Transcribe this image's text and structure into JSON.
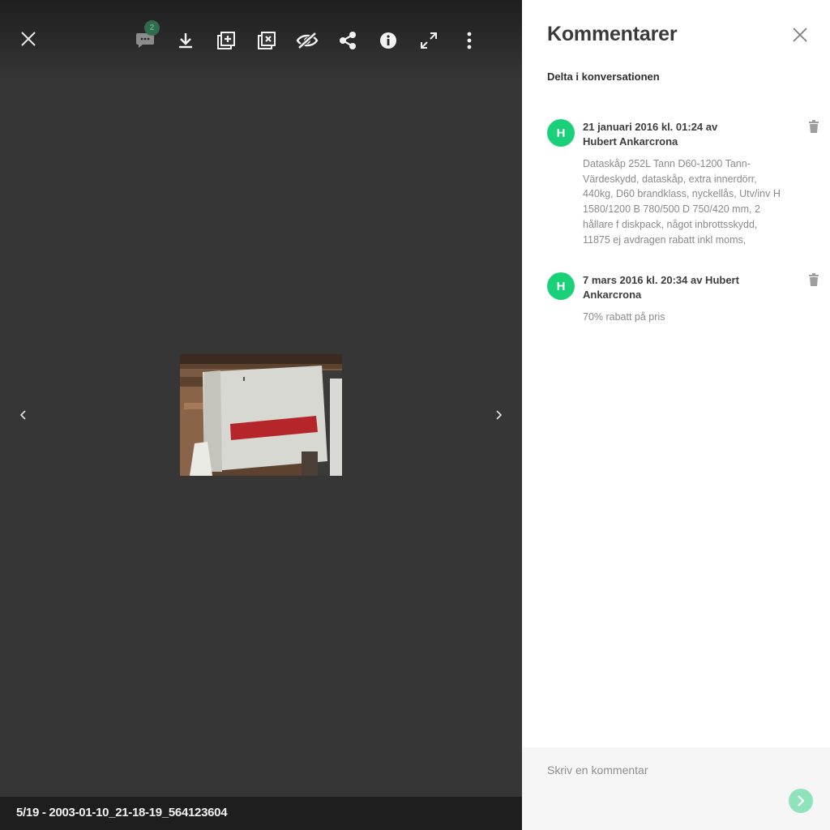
{
  "toolbar": {
    "comment_count": "2",
    "icons": [
      "close-icon",
      "comments-icon",
      "download-icon",
      "add-to-album-icon",
      "remove-from-album-icon",
      "hide-icon",
      "share-icon",
      "info-icon",
      "fullscreen-icon",
      "more-icon"
    ]
  },
  "viewer": {
    "caption": "5/19 - 2003-01-10_21-18-19_564123604",
    "background": "#363636"
  },
  "panel": {
    "title": "Kommentarer",
    "join_label": "Delta i konversationen",
    "comments": [
      {
        "avatar_initial": "H",
        "header": "21 januari 2016 kl. 01:24 av Hubert Ankarcrona",
        "body": "Dataskåp 252L Tann D60-1200 Tann-Värdeskydd, dataskåp, extra innerdörr, 440kg, D60 brandklass, nyckellås, Utv/inv H 1580/1200 B 780/500 D 750/420 mm, 2 hållare f diskpack, något inbrottsskydd, 11875 ej avdragen rabatt inkl moms,"
      },
      {
        "avatar_initial": "H",
        "header": "7 mars 2016 kl. 20:34 av Hubert Ankarcrona",
        "body": "70% rabatt på pris"
      }
    ],
    "composer_placeholder": "Skriv en kommentar"
  },
  "colors": {
    "accent": "#1ad17a",
    "send_button": "#8fe3bc",
    "badge": "#2f6b4c"
  }
}
